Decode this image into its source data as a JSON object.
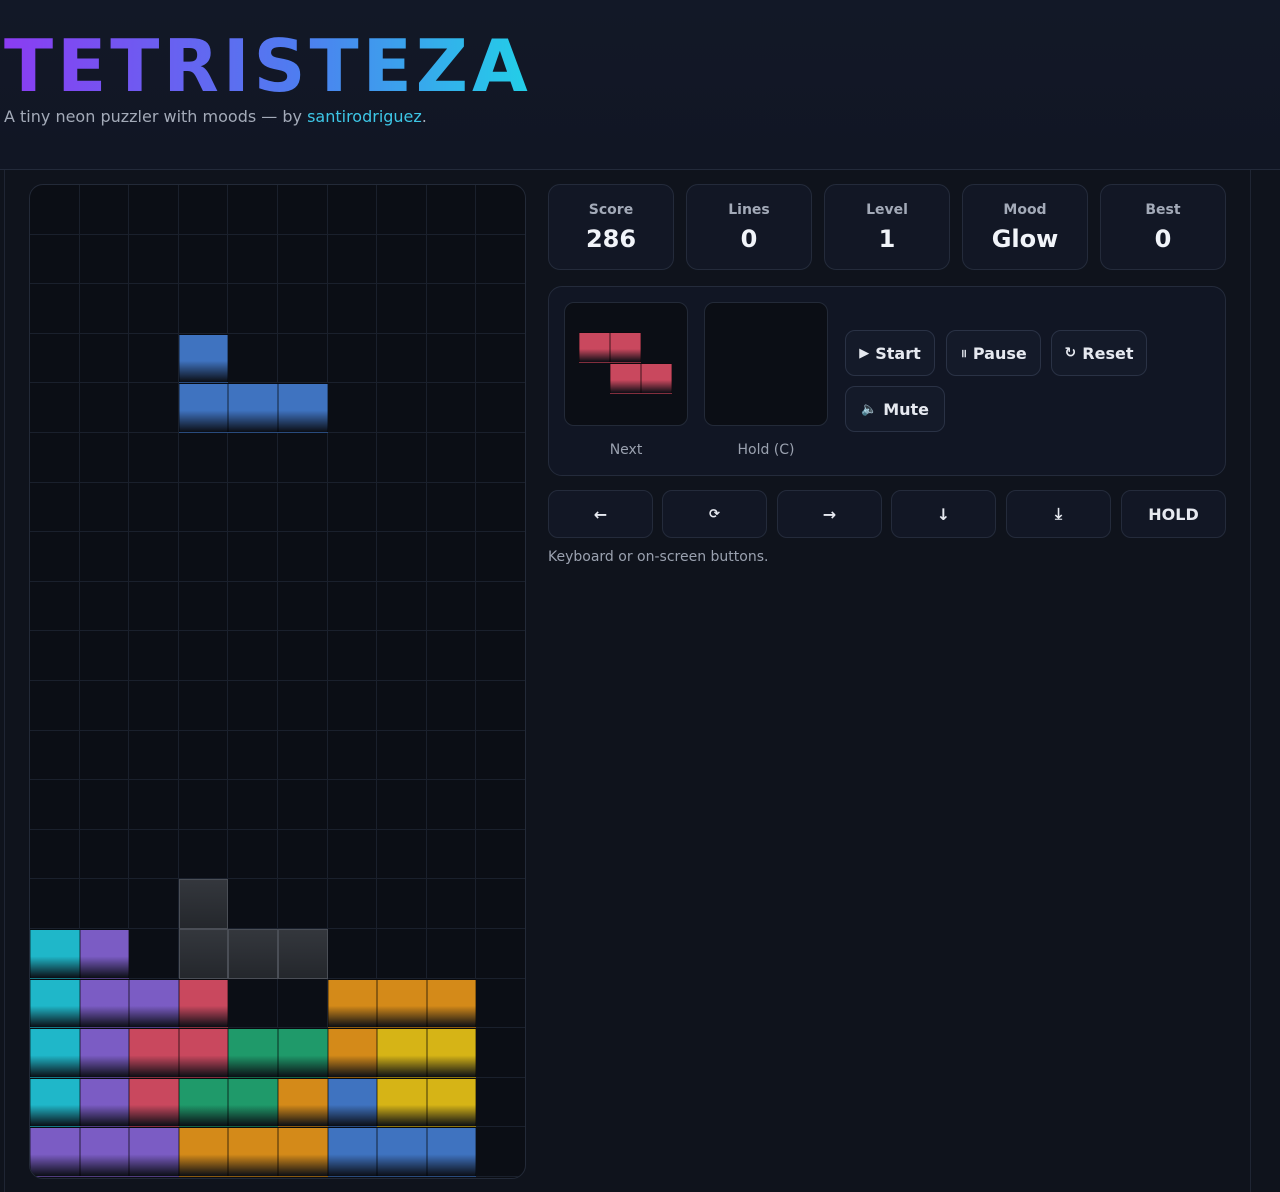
{
  "header": {
    "title": "TETRISTEZA",
    "subtitle_prefix": "A tiny neon puzzler with moods — by ",
    "author": "santirodriguez",
    "subtitle_suffix": "."
  },
  "stats": [
    {
      "label": "Score",
      "value": "286"
    },
    {
      "label": "Lines",
      "value": "0"
    },
    {
      "label": "Level",
      "value": "1"
    },
    {
      "label": "Mood",
      "value": "Glow"
    },
    {
      "label": "Best",
      "value": "0"
    }
  ],
  "preview": {
    "next_label": "Next",
    "hold_label": "Hold (C)",
    "next_piece": "Z"
  },
  "buttons": {
    "start": {
      "icon": "▶",
      "label": "Start"
    },
    "pause": {
      "icon": "॥",
      "label": "Pause"
    },
    "reset": {
      "icon": "↻",
      "label": "Reset"
    },
    "mute": {
      "icon": "🔈",
      "label": "Mute"
    }
  },
  "controls": [
    {
      "name": "move-left",
      "label": "←"
    },
    {
      "name": "rotate",
      "label": "⟳"
    },
    {
      "name": "move-right",
      "label": "→"
    },
    {
      "name": "soft-drop",
      "label": "↓"
    },
    {
      "name": "hard-drop",
      "label": "⤓"
    },
    {
      "name": "hold",
      "label": "HOLD"
    }
  ],
  "hint": "Keyboard or on-screen buttons.",
  "colors": {
    "I": "#1fb7c9",
    "T": "#7b5cc4",
    "Z": "#c9485e",
    "S": "#1f9a6a",
    "L": "#d48a19",
    "O": "#d6b416",
    "J": "#3f73c0",
    "G": "#2a2d33"
  },
  "board": {
    "cols": 10,
    "rows": 20,
    "rows_data": [
      "..........",
      "..........",
      "..........",
      "..........",
      "...J......",
      "...JJJ....",
      "..........",
      "..........",
      "..........",
      "..........",
      "..........",
      "..........",
      "..........",
      "..........",
      "..........",
      "..........",
      "..........",
      "...G......",
      "IT.GGG....",
      "ITTZ..LLL.",
      "ITZZSSLOO.",
      "ITZSSLJOO.",
      "TTTLLLJJJ."
    ]
  }
}
